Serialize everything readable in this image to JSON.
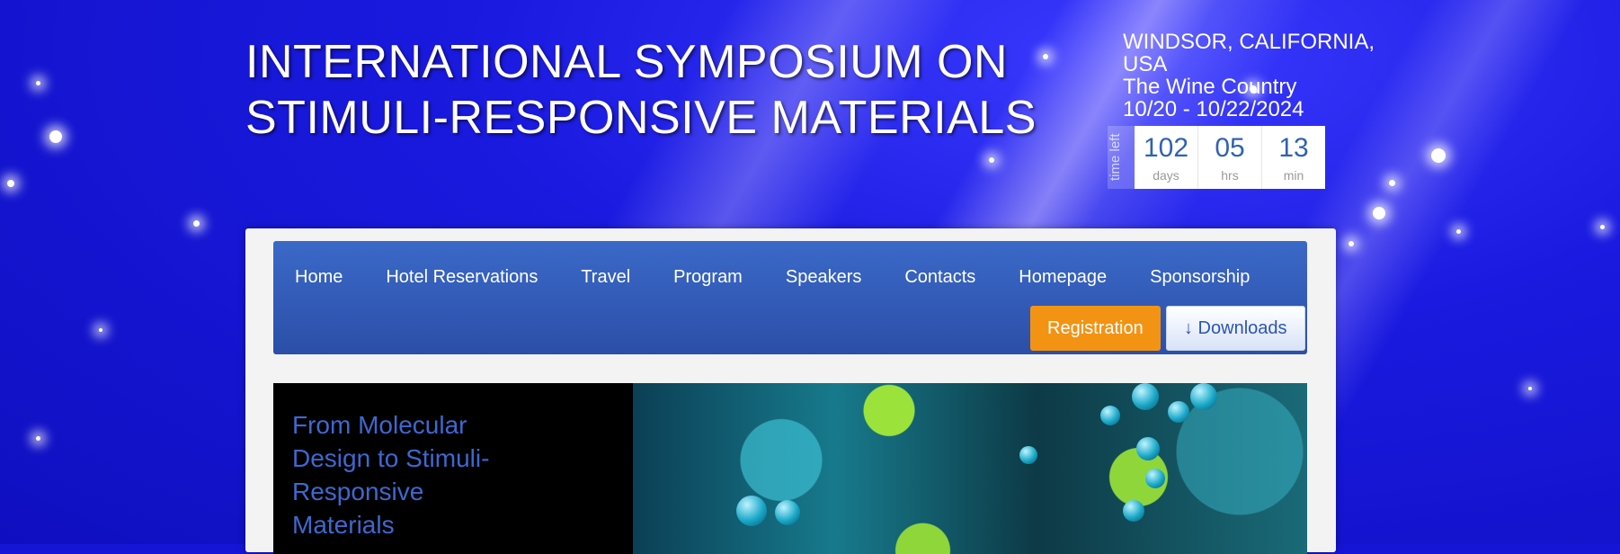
{
  "header": {
    "title_line1": "INTERNATIONAL SYMPOSIUM ON",
    "title_line2": "STIMULI-RESPONSIVE MATERIALS",
    "location_line1": "WINDSOR, CALIFORNIA,",
    "location_line2": "USA",
    "region": "The Wine Country",
    "dates": "10/20 - 10/22/2024"
  },
  "countdown": {
    "label": "time left",
    "days": "102",
    "days_label": "days",
    "hours": "05",
    "hours_label": "hrs",
    "minutes": "13",
    "minutes_label": "min"
  },
  "nav": {
    "items": [
      "Home",
      "Hotel Reservations",
      "Travel",
      "Program",
      "Speakers",
      "Contacts",
      "Homepage",
      "Sponsorship"
    ],
    "registration": "Registration",
    "downloads": "↓ Downloads"
  },
  "hero": {
    "tagline": "From Molecular Design to Stimuli-Responsive Materials"
  },
  "colors": {
    "background": "#1515d6",
    "nav": "#3b69c8",
    "registration_button": "#f39313",
    "tagline": "#3e68d0",
    "countdown_number": "#2f62b4"
  }
}
